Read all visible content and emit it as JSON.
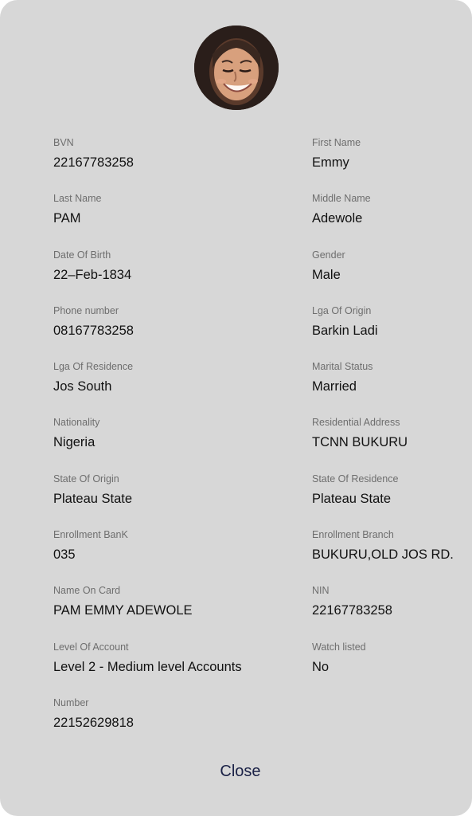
{
  "profile": {
    "fields": [
      {
        "label": "BVN",
        "value": "22167783258"
      },
      {
        "label": "First Name",
        "value": "Emmy"
      },
      {
        "label": "Last Name",
        "value": "PAM"
      },
      {
        "label": "Middle Name",
        "value": "Adewole"
      },
      {
        "label": "Date Of Birth",
        "value": "22–Feb-1834"
      },
      {
        "label": "Gender",
        "value": "Male"
      },
      {
        "label": "Phone number",
        "value": "08167783258"
      },
      {
        "label": "Lga Of Origin",
        "value": "Barkin Ladi"
      },
      {
        "label": "Lga Of Residence",
        "value": "Jos South"
      },
      {
        "label": "Marital Status",
        "value": "Married"
      },
      {
        "label": "Nationality",
        "value": "Nigeria"
      },
      {
        "label": "Residential Address",
        "value": "TCNN BUKURU"
      },
      {
        "label": "State Of Origin",
        "value": "Plateau State"
      },
      {
        "label": "State Of Residence",
        "value": "Plateau State"
      },
      {
        "label": "Enrollment BanK",
        "value": "035"
      },
      {
        "label": "Enrollment Branch",
        "value": "BUKURU,OLD JOS RD."
      },
      {
        "label": "Name On Card",
        "value": "PAM EMMY  ADEWOLE"
      },
      {
        "label": "NIN",
        "value": "22167783258"
      },
      {
        "label": "Level Of Account",
        "value": "Level 2 - Medium level Accounts"
      },
      {
        "label": "Watch listed",
        "value": "No"
      },
      {
        "label": "Number",
        "value": "22152629818"
      }
    ]
  },
  "close_label": "Close",
  "colors": {
    "modal_background": "#d7d7d7",
    "label_text": "#6e6e6e",
    "value_text": "#111111",
    "close_text": "#1a2146"
  }
}
